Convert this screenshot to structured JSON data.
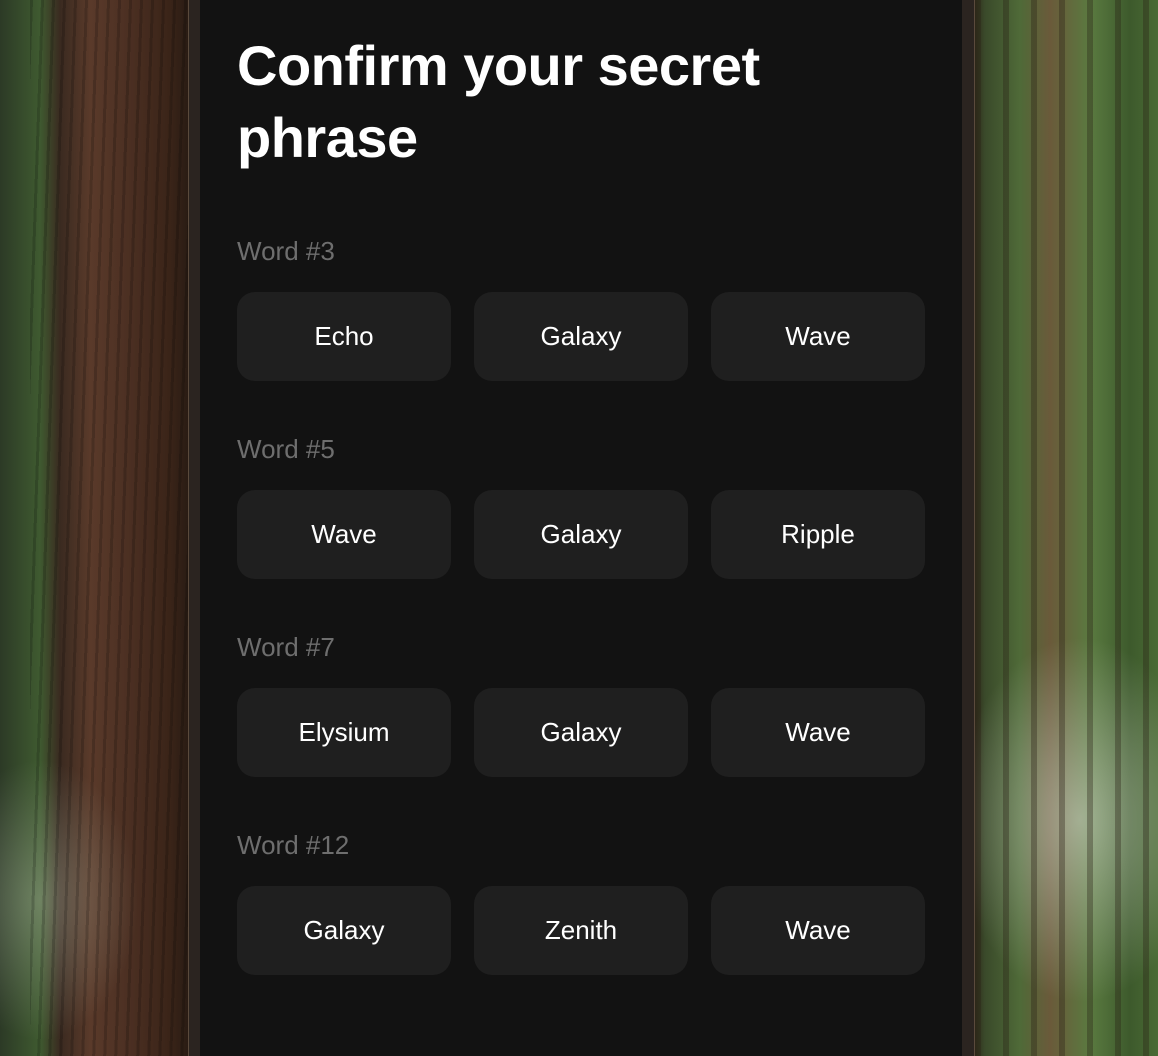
{
  "screen": {
    "title": "Confirm your secret phrase"
  },
  "groups": [
    {
      "label": "Word #3",
      "options": [
        "Echo",
        "Galaxy",
        "Wave"
      ]
    },
    {
      "label": "Word #5",
      "options": [
        "Wave",
        "Galaxy",
        "Ripple"
      ]
    },
    {
      "label": "Word #7",
      "options": [
        "Elysium",
        "Galaxy",
        "Wave"
      ]
    },
    {
      "label": "Word #12",
      "options": [
        "Galaxy",
        "Zenith",
        "Wave"
      ]
    }
  ],
  "colors": {
    "screen_background": "#121212",
    "option_background": "#1f1f1f",
    "label_text": "#6e6e6e",
    "primary_text": "#ffffff"
  }
}
